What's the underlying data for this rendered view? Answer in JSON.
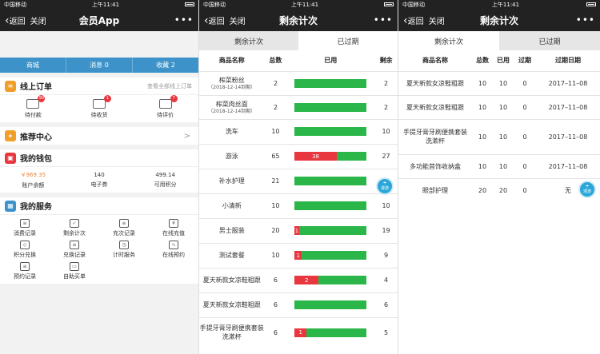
{
  "status": {
    "carrier": "中国移动",
    "time": "上午11:41"
  },
  "nav": {
    "back": "返回",
    "close": "关闭",
    "more": "•••"
  },
  "p1": {
    "title": "会员App",
    "tabs": [
      "商城",
      "消息 0",
      "收藏 2"
    ],
    "orders": {
      "title": "线上订单",
      "more": "查看全部线上订单",
      "items": [
        {
          "label": "待付款",
          "badge": "90"
        },
        {
          "label": "待收货",
          "badge": "1"
        },
        {
          "label": "待评价",
          "badge": "7"
        }
      ]
    },
    "recommend": {
      "title": "推荐中心",
      "arrow": ">"
    },
    "wallet": {
      "title": "我的钱包",
      "items": [
        {
          "value": "￥969.35",
          "label": "账户余额"
        },
        {
          "value": "140",
          "label": "电子券"
        },
        {
          "value": "499.14",
          "label": "可用积分"
        }
      ]
    },
    "services": {
      "title": "我的服务",
      "items": [
        {
          "label": "消费记录",
          "icon": "≡"
        },
        {
          "label": "剩余计次",
          "icon": "✓"
        },
        {
          "label": "充次记录",
          "icon": "≡"
        },
        {
          "label": "在线充值",
          "icon": "¥"
        },
        {
          "label": "积分兑换",
          "icon": "◇"
        },
        {
          "label": "兑换记录",
          "icon": "≡"
        },
        {
          "label": "计时服务",
          "icon": "◷"
        },
        {
          "label": "在线预约",
          "icon": "∿"
        },
        {
          "label": "预约记录",
          "icon": "≡"
        },
        {
          "label": "自助买单",
          "icon": "▭"
        }
      ]
    }
  },
  "p2": {
    "title": "剩余计次",
    "seg": [
      "剩余计次",
      "已过期"
    ],
    "headers": [
      "商品名称",
      "总数",
      "已用",
      "剩余"
    ],
    "rows": [
      {
        "name": "榨菜粉丝",
        "sub": "（2018-12-14到期）",
        "total": "2",
        "used": 0,
        "usedLabel": "",
        "left": "2"
      },
      {
        "name": "榨菜肉丝面",
        "sub": "（2018-12-14到期）",
        "total": "2",
        "used": 0,
        "usedLabel": "",
        "left": "2"
      },
      {
        "name": "洗车",
        "sub": "",
        "total": "10",
        "used": 0,
        "usedLabel": "",
        "left": "10"
      },
      {
        "name": "游泳",
        "sub": "",
        "total": "65",
        "used": 38,
        "usedLabel": "38",
        "left": "27"
      },
      {
        "name": "补水护理",
        "sub": "",
        "total": "21",
        "used": 0,
        "usedLabel": "",
        "left": ""
      },
      {
        "name": "小清新",
        "sub": "",
        "total": "10",
        "used": 0,
        "usedLabel": "",
        "left": "10"
      },
      {
        "name": "男士服装",
        "sub": "",
        "total": "20",
        "used": 1,
        "usedLabel": "1",
        "left": "19"
      },
      {
        "name": "测试套餐",
        "sub": "",
        "total": "10",
        "used": 1,
        "usedLabel": "1",
        "left": "9"
      },
      {
        "name": "夏天新款女凉鞋粗跟",
        "sub": "",
        "total": "6",
        "used": 2,
        "usedLabel": "2",
        "left": "4"
      },
      {
        "name": "夏天新款女凉鞋粗跟",
        "sub": "",
        "total": "6",
        "used": 0,
        "usedLabel": "",
        "left": "6"
      },
      {
        "name": "手提牙膏牙刷便携套装洗漱杯",
        "sub": "",
        "total": "6",
        "used": 1,
        "usedLabel": "1",
        "left": "5"
      }
    ],
    "fab": "漫游"
  },
  "p3": {
    "title": "剩余计次",
    "seg": [
      "剩余计次",
      "已过期"
    ],
    "headers": [
      "商品名称",
      "总数",
      "已用",
      "过期",
      "过期日期"
    ],
    "rows": [
      {
        "name": "夏天新款女凉鞋粗跟",
        "total": "10",
        "used": "10",
        "expired": "0",
        "date": "2017–11–08"
      },
      {
        "name": "夏天新款女凉鞋粗跟",
        "total": "10",
        "used": "10",
        "expired": "0",
        "date": "2017–11–08"
      },
      {
        "name": "手提牙膏牙刷便携套装洗漱杯",
        "total": "10",
        "used": "10",
        "expired": "0",
        "date": "2017–11–08"
      },
      {
        "name": "多功能首饰收纳盒",
        "total": "10",
        "used": "10",
        "expired": "0",
        "date": "2017–11–08"
      },
      {
        "name": "眼部护理",
        "total": "20",
        "used": "20",
        "expired": "0",
        "date": "无"
      }
    ],
    "fab": "漫游"
  },
  "colors": {
    "tabbar": "#3d93c9",
    "green": "#2bb64a",
    "red": "#e8373f",
    "orange": "#f0a02a"
  }
}
